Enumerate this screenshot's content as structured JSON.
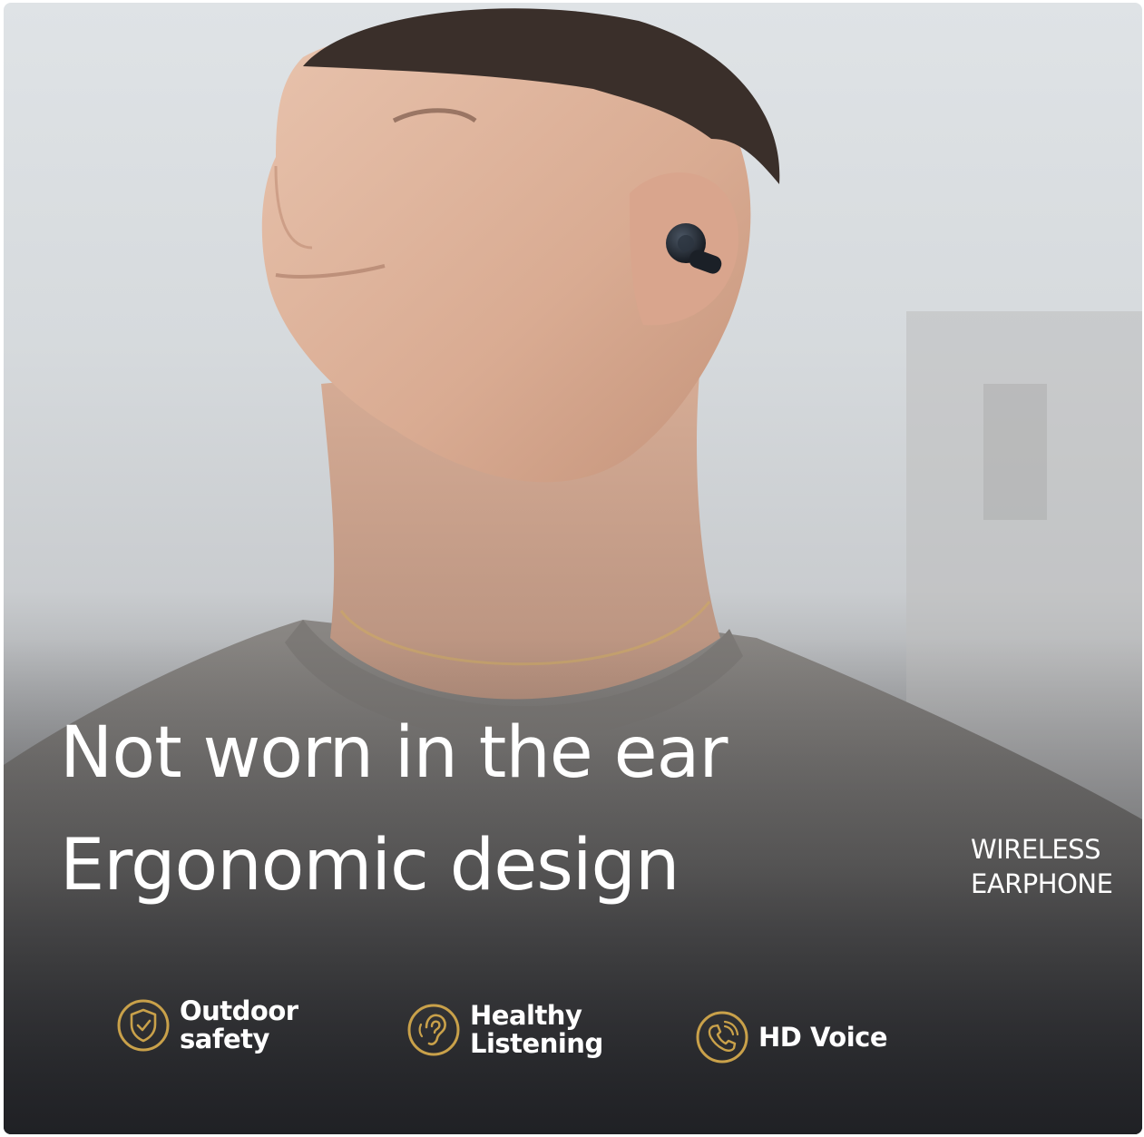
{
  "headline": {
    "line1": "Not worn in the ear",
    "line2": "Ergonomic design"
  },
  "side_label": {
    "line1": "WIRELESS",
    "line2": "EARPHONE"
  },
  "features": [
    {
      "line1": "Outdoor",
      "line2": "safety",
      "icon": "shield-check-icon"
    },
    {
      "line1": "Healthy",
      "line2": "Listening",
      "icon": "ear-icon"
    },
    {
      "line1": "HD Voice",
      "icon": "phone-icon"
    }
  ],
  "colors": {
    "accent_gold": "#c9a14a",
    "text": "#ffffff",
    "background_light": "#dfe3e6",
    "background_dark": "#2b2c30"
  }
}
